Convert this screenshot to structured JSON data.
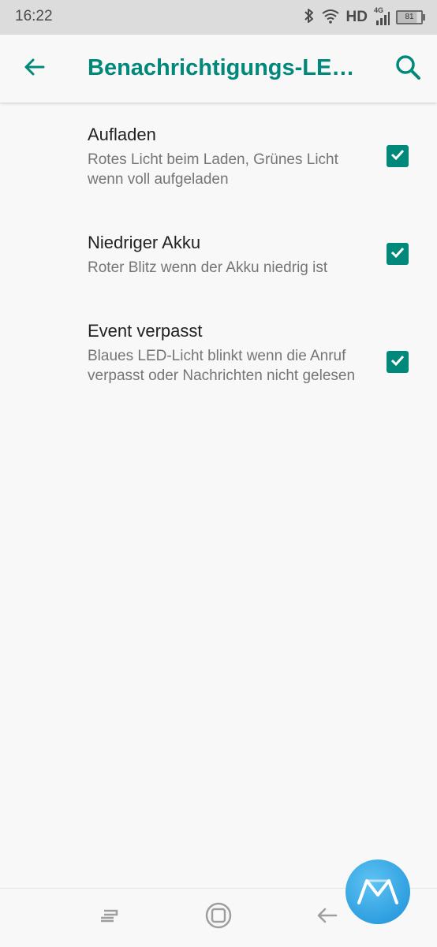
{
  "status_bar": {
    "time": "16:22",
    "network_label": "HD",
    "network_type": "4G",
    "battery_level": "81",
    "icons": [
      "bluetooth-icon",
      "wifi-icon",
      "signal-icon",
      "battery-icon"
    ]
  },
  "app_bar": {
    "title": "Benachrichtigungs-LED…",
    "back_icon": "arrow-back-icon",
    "search_icon": "search-icon",
    "accent_color": "#00897b"
  },
  "preferences": [
    {
      "title": "Aufladen",
      "summary": "Rotes Licht beim Laden, Grünes Licht wenn voll aufgeladen",
      "checked": true
    },
    {
      "title": "Niedriger Akku",
      "summary": "Roter Blitz wenn der Akku niedrig ist",
      "checked": true
    },
    {
      "title": "Event verpasst",
      "summary": "Blaues LED-Licht blinkt wenn die Anruf verpasst oder Nachrichten nicht gelesen",
      "checked": true
    }
  ],
  "nav_bar": {
    "buttons": [
      "recents-icon",
      "home-icon",
      "back-icon"
    ]
  },
  "watermark": {
    "icon": "logo-watermark-icon"
  }
}
